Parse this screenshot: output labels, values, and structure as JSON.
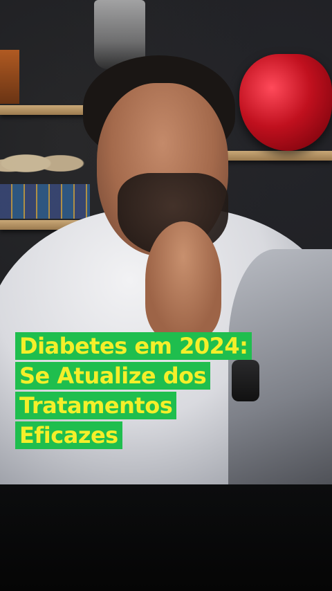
{
  "caption": {
    "lines": [
      "Diabetes em 2024:",
      "Se Atualize dos",
      "Tratamentos",
      "Eficazes"
    ]
  },
  "colors": {
    "caption_background": "#1fbe4e",
    "caption_text": "#f4ef2a"
  }
}
